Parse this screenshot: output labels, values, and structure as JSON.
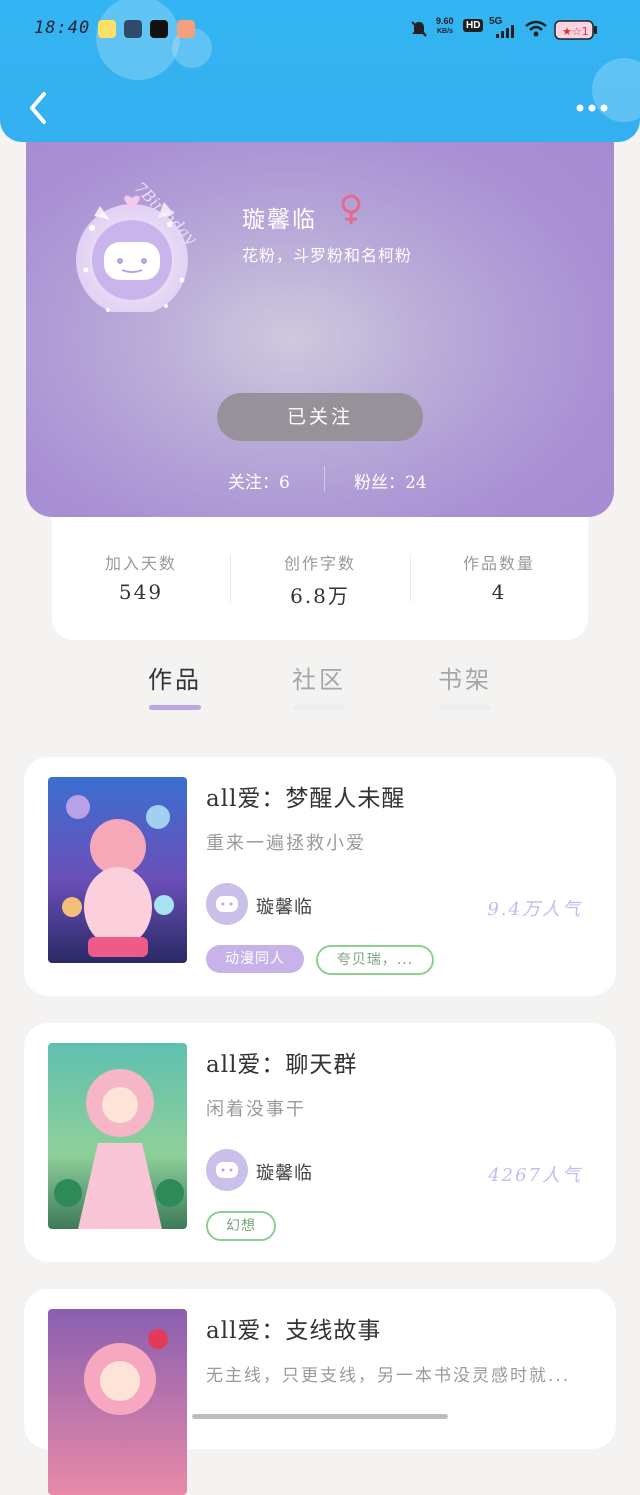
{
  "status_bar": {
    "time": "18:40",
    "speed": "9.60",
    "speed_unit": "KB/s",
    "hd": "HD",
    "network": "5G"
  },
  "colors": {
    "header": "#34b4f2",
    "profile_bg": "#a98fd4",
    "accent_purple": "#c7b3ea",
    "tag_green": "#8ccf91"
  },
  "profile": {
    "avatar_badge_text": "7Birthday",
    "username": "璇馨临",
    "gender_icon": "female-symbol",
    "tagline": "花粉，斗罗粉和名柯粉",
    "follow_button": "已关注",
    "following": "关注：6",
    "fans": "粉丝：24"
  },
  "stats": [
    {
      "label": "加入天数",
      "value": "549"
    },
    {
      "label": "创作字数",
      "value": "6.8万"
    },
    {
      "label": "作品数量",
      "value": "4"
    }
  ],
  "tabs": [
    {
      "label": "作品",
      "active": true
    },
    {
      "label": "社区",
      "active": false
    },
    {
      "label": "书架",
      "active": false
    }
  ],
  "works": [
    {
      "title": "all爱：梦醒人未醒",
      "desc": "重来一遍拯救小爱",
      "author": "璇馨临",
      "popularity": "9.4万人气",
      "tags": [
        {
          "text": "动漫同人",
          "style": "fill"
        },
        {
          "text": "夸贝瑞，...",
          "style": "outline"
        }
      ]
    },
    {
      "title": "all爱：聊天群",
      "desc": "闲着没事干",
      "author": "璇馨临",
      "popularity": "4267人气",
      "tags": [
        {
          "text": "幻想",
          "style": "outline"
        }
      ]
    },
    {
      "title": "all爱：支线故事",
      "desc": "无主线，只更支线，另一本书没灵感时就...",
      "author": "",
      "popularity": "",
      "tags": []
    }
  ]
}
